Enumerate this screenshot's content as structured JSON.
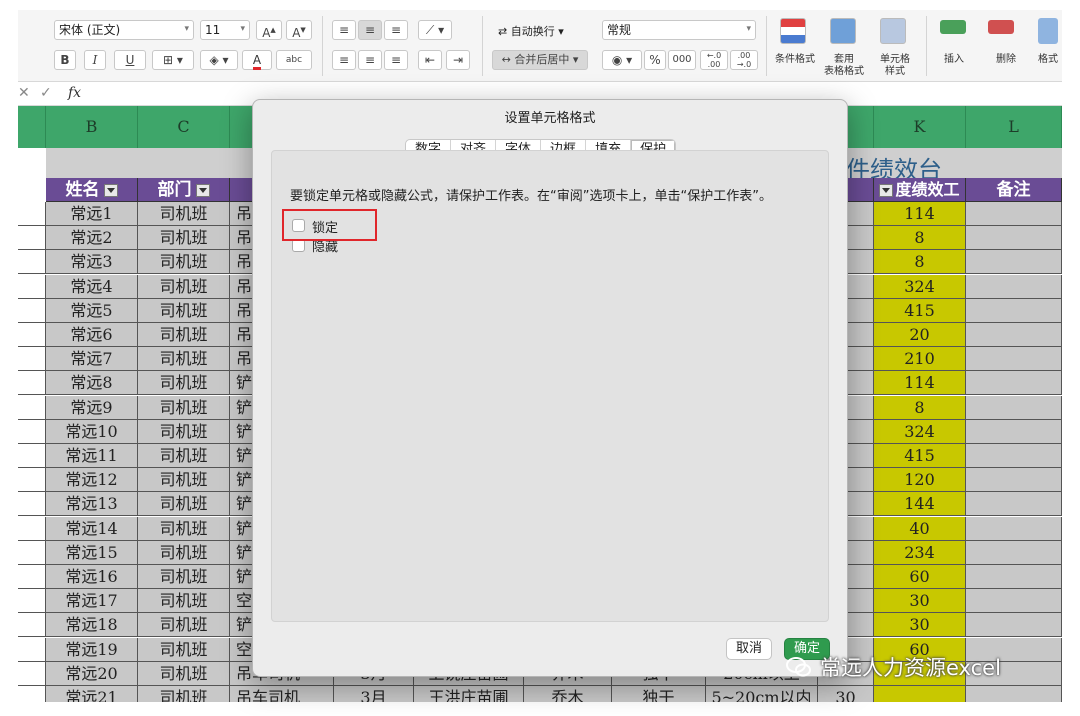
{
  "ribbon": {
    "font_name": "宋体 (正文)",
    "font_size": "11",
    "bold": "B",
    "italic": "I",
    "underline": "U",
    "font_color_label": "A",
    "abc_label": "abc",
    "wrap_text": "自动换行",
    "merge_center": "合并后居中",
    "number_format": "常规",
    "percent": "%",
    "thousands": "000",
    "inc_decimal": ".0 .00",
    "dec_decimal": ".00 .0",
    "conditional_format": "条件格式",
    "table_format": "套用\n表格格式",
    "cell_style": "单元格\n样式",
    "insert": "插入",
    "delete": "删除",
    "format": "格式",
    "accent_green": "#3ea66a"
  },
  "formula_bar": {
    "fx": "fx"
  },
  "sheet": {
    "columns": [
      "B",
      "C",
      "K",
      "L"
    ],
    "title_fragment": "件绩效台",
    "headers": {
      "name": "姓名",
      "dept": "部门",
      "perf": "度绩效工",
      "remark": "备注"
    },
    "rows": [
      {
        "name": "常远1",
        "dept": "司机班",
        "frag": "吊",
        "perf": "114"
      },
      {
        "name": "常远2",
        "dept": "司机班",
        "frag": "吊",
        "perf": "8"
      },
      {
        "name": "常远3",
        "dept": "司机班",
        "frag": "吊",
        "perf": "8"
      },
      {
        "name": "常远4",
        "dept": "司机班",
        "frag": "吊",
        "perf": "324"
      },
      {
        "name": "常远5",
        "dept": "司机班",
        "frag": "吊",
        "perf": "415"
      },
      {
        "name": "常远6",
        "dept": "司机班",
        "frag": "吊",
        "perf": "20"
      },
      {
        "name": "常远7",
        "dept": "司机班",
        "frag": "吊",
        "perf": "210"
      },
      {
        "name": "常远8",
        "dept": "司机班",
        "frag": "铲",
        "perf": "114"
      },
      {
        "name": "常远9",
        "dept": "司机班",
        "frag": "铲",
        "perf": "8"
      },
      {
        "name": "常远10",
        "dept": "司机班",
        "frag": "铲",
        "perf": "324"
      },
      {
        "name": "常远11",
        "dept": "司机班",
        "frag": "铲",
        "perf": "415"
      },
      {
        "name": "常远12",
        "dept": "司机班",
        "frag": "铲",
        "perf": "120"
      },
      {
        "name": "常远13",
        "dept": "司机班",
        "frag": "铲",
        "perf": "144"
      },
      {
        "name": "常远14",
        "dept": "司机班",
        "frag": "铲",
        "perf": "40"
      },
      {
        "name": "常远15",
        "dept": "司机班",
        "frag": "铲",
        "perf": "234"
      },
      {
        "name": "常远16",
        "dept": "司机班",
        "frag": "铲",
        "perf": "60"
      },
      {
        "name": "常远17",
        "dept": "司机班",
        "frag": "空",
        "perf": "30"
      },
      {
        "name": "常远18",
        "dept": "司机班",
        "frag": "铲",
        "perf": "30"
      },
      {
        "name": "常远19",
        "dept": "司机班",
        "frag": "空",
        "perf": "60"
      },
      {
        "name": "常远20",
        "dept": "司机班",
        "frag": "吊车司机",
        "perf": ""
      },
      {
        "name": "常远21",
        "dept": "司机班",
        "frag": "吊车司机",
        "perf": ""
      }
    ],
    "row20_extra": {
      "month": "3月",
      "place": "上饶庄苗圃",
      "type": "乔木",
      "mode": "独干",
      "spec": "20cm以上",
      "count": ""
    },
    "row21_extra": {
      "month": "3月",
      "place": "王洪庄苗圃",
      "type": "乔木",
      "mode": "独干",
      "spec": "5~20cm以内",
      "count": "30"
    }
  },
  "dialog": {
    "title": "设置单元格格式",
    "tabs": [
      "数字",
      "对齐",
      "字体",
      "边框",
      "填充",
      "保护"
    ],
    "active_tab": "保护",
    "description": "要锁定单元格或隐藏公式，请保护工作表。在“审阅”选项卡上，单击“保护工作表”。",
    "lock_label": "锁定",
    "hide_label": "隐藏",
    "lock_checked": false,
    "hide_checked": false,
    "cancel": "取消",
    "ok": "确定"
  },
  "watermark": "常远人力资源excel"
}
